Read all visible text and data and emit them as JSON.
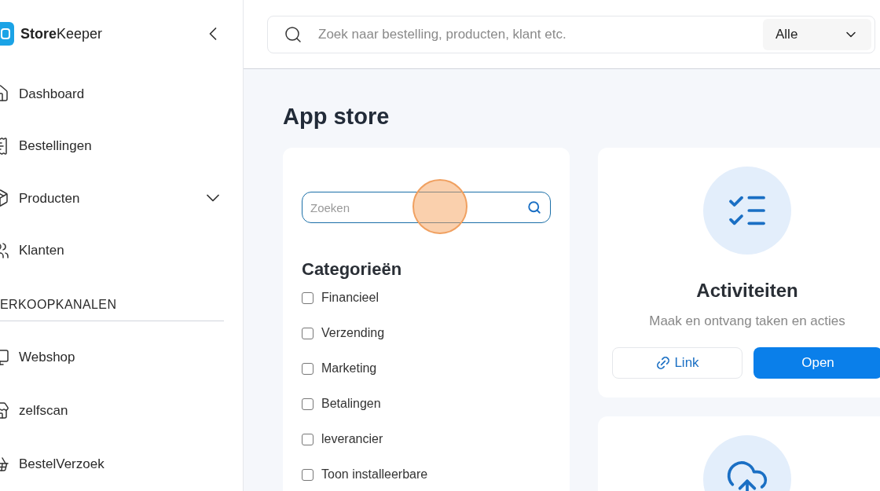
{
  "sidebar": {
    "logo": "**Store**Keeper",
    "items": [
      {
        "label": "Dashboard",
        "expandable": false
      },
      {
        "label": "Bestellingen",
        "expandable": false
      },
      {
        "label": "Producten",
        "expandable": true
      },
      {
        "label": "Klanten",
        "expandable": false
      }
    ],
    "section": "ERKOOPKANALEN",
    "channels": [
      {
        "label": "Webshop"
      },
      {
        "label": "zelfscan"
      },
      {
        "label": "BestelVerzoek"
      }
    ]
  },
  "header": {
    "search": {
      "placeholder": "Zoek naar bestelling, producten, klant etc."
    },
    "scope": "Alle"
  },
  "page_title": "App store",
  "filters": {
    "search": {
      "placeholder": "Zoeken"
    },
    "heading": "Categorieën",
    "categories": [
      {
        "label": "Financieel",
        "checked": false
      },
      {
        "label": "Verzending",
        "checked": false
      },
      {
        "label": "Marketing",
        "checked": false
      },
      {
        "label": "Betalingen",
        "checked": false
      },
      {
        "label": "leverancier",
        "checked": false
      },
      {
        "label": "Toon installeerbare",
        "checked": false
      }
    ]
  },
  "apps": [
    {
      "kind": "tasks",
      "title": "Activiteiten",
      "description": "Maak en ontvang taken en acties",
      "buttons": [
        {
          "label": "Link",
          "kind": "link"
        },
        {
          "label": "Open",
          "kind": "primary"
        }
      ]
    },
    {
      "kind": "upload"
    }
  ]
}
